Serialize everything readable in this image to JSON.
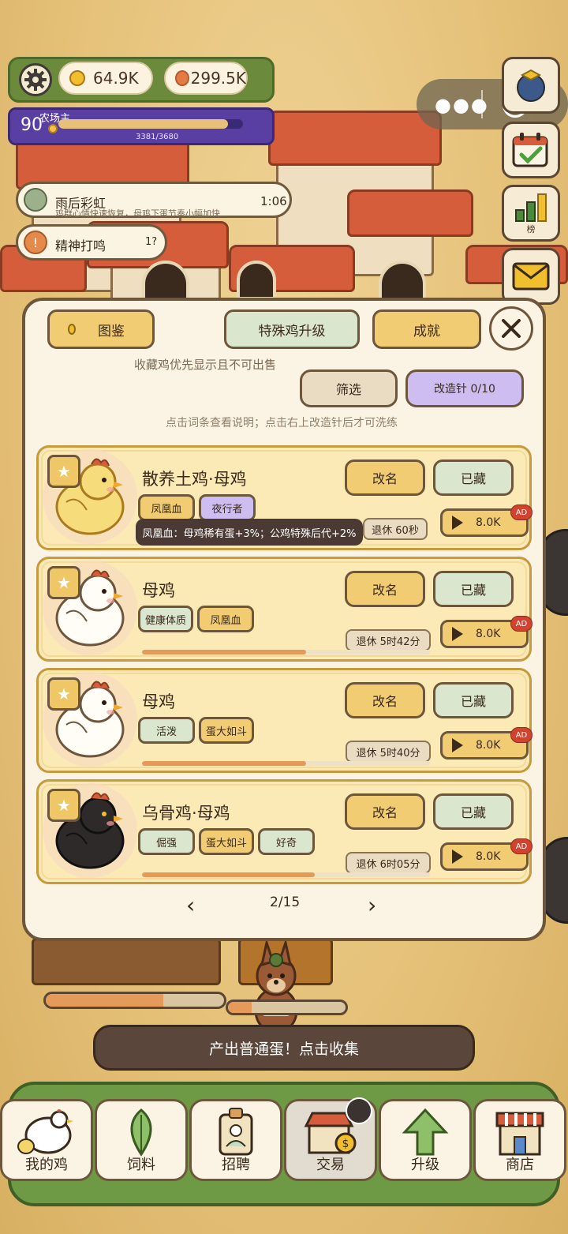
{
  "hud": {
    "coins": "64.9K",
    "copper": "299.5K",
    "level": "90",
    "level_title": "农场主",
    "xp_text": "3381/3680",
    "xp_fraction": 0.919
  },
  "status_effects": [
    {
      "title": "雨后彩虹",
      "sub": "鸡群心情快速恢复，母鸡下蛋节奏小幅加快",
      "time": "1:06",
      "icon": "cloud-icon"
    },
    {
      "title": "精神打鸣",
      "sub": "",
      "time": "1?",
      "icon": "alert-icon"
    }
  ],
  "panel": {
    "tabs": [
      "图鉴",
      "特殊鸡升级",
      "成就"
    ],
    "hint_top": "收藏鸡优先显示且不可出售",
    "filter_label": "筛选",
    "modifier_label": "改造针 0/10",
    "hint_bottom": "点击词条查看说明；点击右上改造针后才可洗练",
    "rename_label": "改名",
    "stored_label": "已藏",
    "sell_value": "8.0K",
    "ad_label": "AD",
    "tooltip": "凤凰血：母鸡稀有蛋+3%；公鸡特殊后代+2%",
    "pager": "2/15",
    "cards": [
      {
        "name": "散养土鸡·母鸡",
        "tags": [
          "凤凰血",
          "夜行者"
        ],
        "retire": "退休 60秒",
        "progress": 0.95,
        "chicken": "yellow"
      },
      {
        "name": "母鸡",
        "tags": [
          "健康体质",
          "凤凰血"
        ],
        "retire": "退休 5时42分",
        "progress": 0.57,
        "chicken": "white"
      },
      {
        "name": "母鸡",
        "tags": [
          "活泼",
          "蛋大如斗"
        ],
        "retire": "退休 5时40分",
        "progress": 0.57,
        "chicken": "white"
      },
      {
        "name": "乌骨鸡·母鸡",
        "tags": [
          "倔强",
          "蛋大如斗",
          "好奇"
        ],
        "retire": "退休 6时05分",
        "progress": 0.6,
        "chicken": "black"
      }
    ]
  },
  "collect_banner": "产出普通蛋！点击收集",
  "progress_bars": [
    0.66,
    0.2
  ],
  "nav": [
    {
      "label": "我的鸡",
      "icon": "chicken-icon"
    },
    {
      "label": "饲料",
      "icon": "leaf-icon"
    },
    {
      "label": "招聘",
      "icon": "badge-icon"
    },
    {
      "label": "交易",
      "icon": "shop-stall-icon"
    },
    {
      "label": "升级",
      "icon": "up-arrow-icon"
    },
    {
      "label": "商店",
      "icon": "store-icon"
    }
  ],
  "side_buttons": [
    {
      "icon": "globe-icon",
      "label": ""
    },
    {
      "icon": "calendar-check-icon",
      "label": ""
    },
    {
      "icon": "leaderboard-icon",
      "label": "榜"
    },
    {
      "icon": "mail-icon",
      "label": ""
    }
  ],
  "colors": {
    "accent_gold": "#f2cc72",
    "accent_mint": "#dbe6cf",
    "accent_purple": "#cdbdf0",
    "hud_green": "#6b8a3c",
    "level_purple": "#5a3fa3"
  }
}
